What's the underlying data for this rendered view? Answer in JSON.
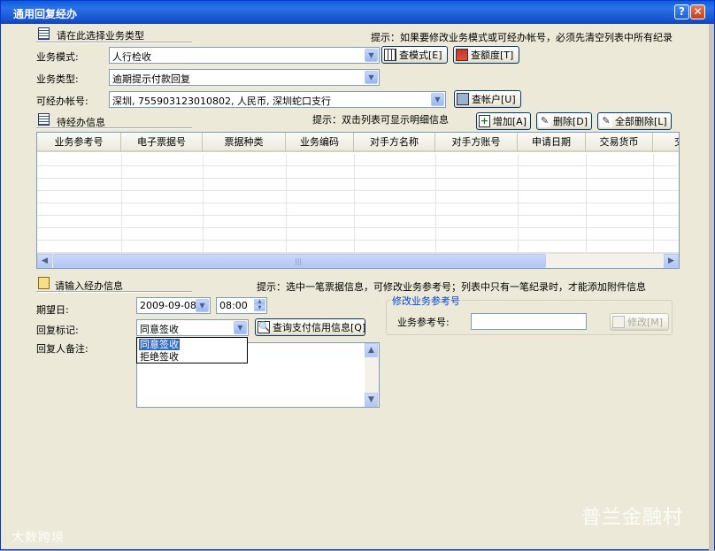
{
  "window": {
    "title": "通用回复经办",
    "help_glyph": "?",
    "close_glyph": "✕"
  },
  "section_type": {
    "title": "请在此选择业务类型",
    "hint": "提示：如果要修改业务模式或可经办帐号，必须先清空列表中所有纪录",
    "mode_label": "业务模式:",
    "mode_value": "人行检收",
    "query_mode_btn": "查模式[E]",
    "query_limit_btn": "查额度[T]",
    "type_label": "业务类型:",
    "type_value": "逾期提示付款回复",
    "account_label": "可经办帐号:",
    "account_value": "深圳, 755903123010802, 人民币, 深圳蛇口支行",
    "query_account_btn": "查帐户[U]"
  },
  "section_pending": {
    "title": "待经办信息",
    "hint": "提示：双击列表可显示明细信息",
    "add_btn": "增加[A]",
    "delete_btn": "删除[D]",
    "delete_all_btn": "全部删除[L]",
    "columns": [
      "业务参考号",
      "电子票据号",
      "票据种类",
      "业务编码",
      "对手方名称",
      "对手方账号",
      "申请日期",
      "交易货币",
      "交"
    ]
  },
  "section_input": {
    "title": "请输入经办信息",
    "hint": "提示：选中一笔票据信息，可修改业务参考号；列表中只有一笔纪录时，才能添加附件信息",
    "date_label": "期望日:",
    "date_value": "2009-09-08",
    "time_value": "08:00",
    "reply_label": "回复标记:",
    "reply_value": "同意签收",
    "reply_options": [
      "同意签收",
      "拒绝签收"
    ],
    "query_credit_btn": "查询支付信用信息[Q]",
    "remark_label": "回复人备注:",
    "remark_value": ""
  },
  "modify_ref": {
    "group_title": "修改业务参考号",
    "ref_label": "业务参考号:",
    "ref_value": "",
    "modify_btn": "修改[M]"
  },
  "watermarks": {
    "left": "大数跨境",
    "right": "普兰金融村"
  }
}
